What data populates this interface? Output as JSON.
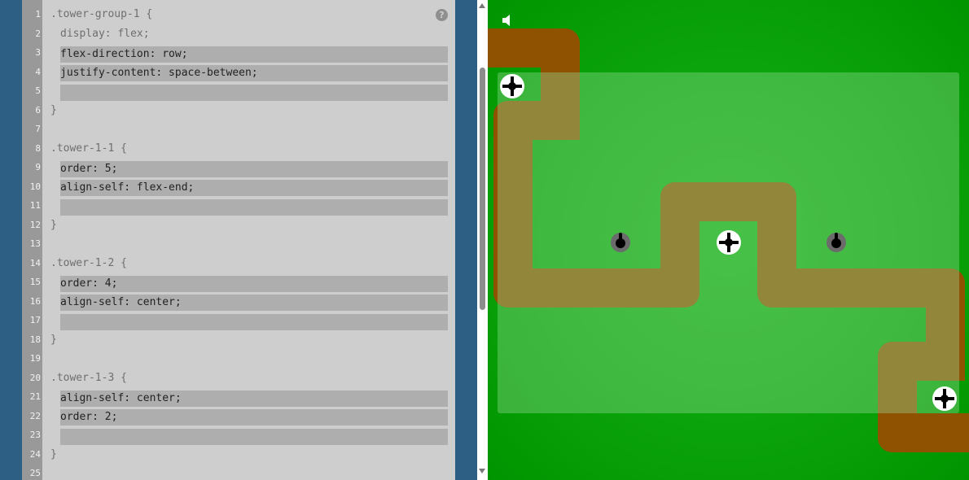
{
  "editor": {
    "help_label": "?",
    "lines": [
      {
        "num": "1",
        "text": ".tower-group-1 {"
      },
      {
        "num": "2",
        "text": "display: flex;"
      },
      {
        "num": "3",
        "text": "flex-direction: row;"
      },
      {
        "num": "4",
        "text": "justify-content: space-between;"
      },
      {
        "num": "5",
        "text": ""
      },
      {
        "num": "6",
        "text": "}"
      },
      {
        "num": "7",
        "text": ""
      },
      {
        "num": "8",
        "text": ".tower-1-1 {"
      },
      {
        "num": "9",
        "text": "order: 5;"
      },
      {
        "num": "10",
        "text": "align-self: flex-end;"
      },
      {
        "num": "11",
        "text": ""
      },
      {
        "num": "12",
        "text": "}"
      },
      {
        "num": "13",
        "text": ""
      },
      {
        "num": "14",
        "text": ".tower-1-2 {"
      },
      {
        "num": "15",
        "text": "order: 4;"
      },
      {
        "num": "16",
        "text": "align-self: center;"
      },
      {
        "num": "17",
        "text": ""
      },
      {
        "num": "18",
        "text": "}"
      },
      {
        "num": "19",
        "text": ""
      },
      {
        "num": "20",
        "text": ".tower-1-3 {"
      },
      {
        "num": "21",
        "text": "align-self: center;"
      },
      {
        "num": "22",
        "text": "order: 2;"
      },
      {
        "num": "23",
        "text": ""
      },
      {
        "num": "24",
        "text": "}"
      },
      {
        "num": "25",
        "text": ""
      }
    ]
  },
  "game": {
    "sound_icon": "speaker-icon",
    "colors": {
      "grass": "#0ba30b",
      "path": "#8e5200",
      "zone": "#96de96"
    },
    "targets": [
      "crosshair-icon",
      "crosshair-icon",
      "crosshair-icon"
    ],
    "towers": [
      "tower-icon",
      "tower-icon"
    ]
  }
}
